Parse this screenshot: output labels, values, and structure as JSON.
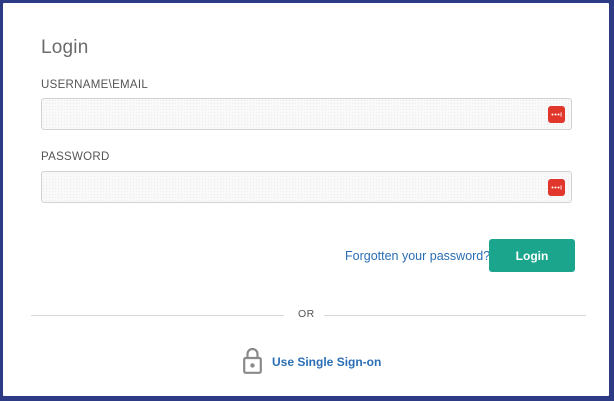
{
  "login": {
    "title": "Login",
    "username_label": "USERNAME\\EMAIL",
    "username_value": "",
    "password_label": "PASSWORD",
    "password_value": "",
    "forgot_link": "Forgotten your password?",
    "login_button": "Login",
    "divider_text": "OR",
    "sso_link": "Use Single Sign-on"
  },
  "icons": {
    "password_manager": "password-manager-icon",
    "sso": "lock-icon"
  },
  "colors": {
    "background": "#2d3b84",
    "login_button": "#1aa58c",
    "link": "#2a6fb5",
    "password_manager_icon": "#e0362c"
  }
}
